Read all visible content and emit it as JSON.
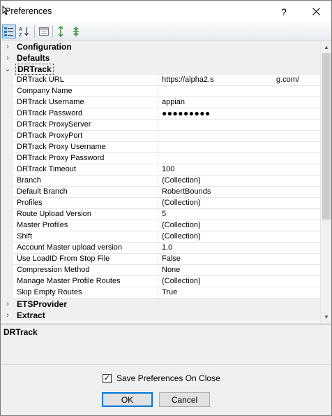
{
  "window": {
    "title": "Preferences",
    "help_button": "?",
    "close_button": "✕"
  },
  "toolbar": {
    "buttons": [
      {
        "icon": "categorized-icon",
        "active": true
      },
      {
        "icon": "sort-alphabetical-icon",
        "active": false
      },
      {
        "icon": "property-pages-icon",
        "active": false
      },
      {
        "icon": "expand-all-icon",
        "active": false
      },
      {
        "icon": "collapse-all-icon",
        "active": false
      }
    ]
  },
  "grid": {
    "categories": {
      "configuration": "Configuration",
      "defaults": "Defaults",
      "drtrack": "DRTrack",
      "etsprovider": "ETSProvider",
      "extract": "Extract"
    },
    "properties": [
      {
        "name": "DRTrack URL",
        "value": "https://alpha2.s",
        "value2": "g.com/"
      },
      {
        "name": "Company Name",
        "value": ""
      },
      {
        "name": "DRTrack Username",
        "value": "appian"
      },
      {
        "name": "DRTrack Password",
        "value": "●●●●●●●●●"
      },
      {
        "name": "DRTrack ProxyServer",
        "value": ""
      },
      {
        "name": "DRTrack ProxyPort",
        "value": ""
      },
      {
        "name": "DRTrack Proxy Username",
        "value": ""
      },
      {
        "name": "DRTrack Proxy Password",
        "value": ""
      },
      {
        "name": "DRTrack Timeout",
        "value": "100"
      },
      {
        "name": "Branch",
        "value": "(Collection)"
      },
      {
        "name": "Default Branch",
        "value": "RobertBounds"
      },
      {
        "name": "Profiles",
        "value": "(Collection)"
      },
      {
        "name": "Route Upload Version",
        "value": "5"
      },
      {
        "name": "Master Profiles",
        "value": "(Collection)"
      },
      {
        "name": "Shift",
        "value": "(Collection)"
      },
      {
        "name": "Account Master upload version",
        "value": "1.0"
      },
      {
        "name": "Use LoadID From Stop File",
        "value": "False"
      },
      {
        "name": "Compression Method",
        "value": "None"
      },
      {
        "name": "Manage Master Profile Routes",
        "value": "(Collection)"
      },
      {
        "name": "Skip Empty Routes",
        "value": "True"
      }
    ]
  },
  "help_pane": {
    "title": "DRTrack"
  },
  "footer": {
    "save_on_close_label": "Save Preferences On Close",
    "save_on_close_checked": true,
    "ok_label": "OK",
    "cancel_label": "Cancel"
  }
}
